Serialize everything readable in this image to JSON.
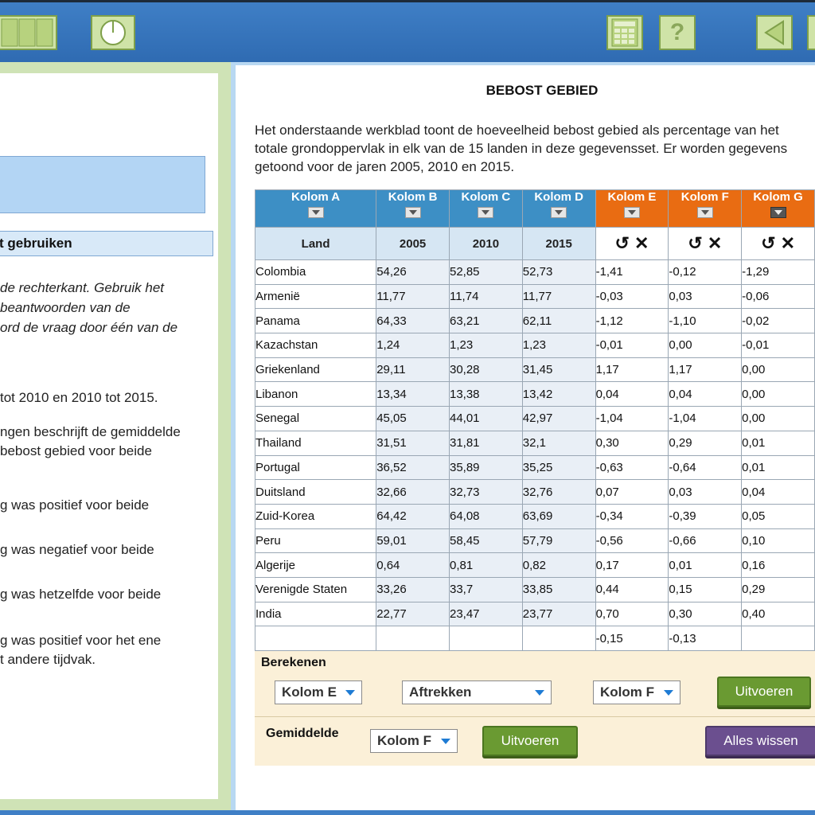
{
  "colors": {
    "toolbar": "#3577bd",
    "accent_blue": "#3d8fc5",
    "accent_orange": "#e96c12",
    "button_green": "#6a9a32",
    "button_purple": "#6b4f8f"
  },
  "toolbar": {
    "icons": [
      "grid-panel-icon",
      "timer-icon",
      "calculator-icon",
      "help-icon",
      "back-arrow-icon"
    ],
    "help_glyph": "?"
  },
  "left": {
    "section_head": "t gebruiken",
    "lines_italic": [
      "de rechterkant. Gebruik het",
      "beantwoorden van de",
      "ord de vraag door één van de"
    ],
    "line_period": "tot 2010 en 2010 tot 2015.",
    "question": [
      "ngen beschrijft de gemiddelde",
      "bebost gebied voor beide"
    ],
    "options": [
      [
        "g was positief voor beide"
      ],
      [
        "g was negatief voor beide"
      ],
      [
        "g was hetzelfde voor beide"
      ],
      [
        "g was positief voor het ene",
        "t andere tijdvak."
      ]
    ]
  },
  "main": {
    "title": "BEBOST GEBIED",
    "description": "Het onderstaande werkblad toont de hoeveelheid bebost gebied als percentage van het totale grondoppervlak in elk van de 15 landen in deze gegevensset. Er worden gegevens getoond voor de jaren 2005, 2010 en 2015."
  },
  "table": {
    "columns": [
      "Kolom A",
      "Kolom B",
      "Kolom C",
      "Kolom D",
      "Kolom E",
      "Kolom F",
      "Kolom G"
    ],
    "subheaders": [
      "Land",
      "2005",
      "2010",
      "2015"
    ],
    "rows": [
      [
        "Colombia",
        "54,26",
        "52,85",
        "52,73",
        "-1,41",
        "-0,12",
        "-1,29"
      ],
      [
        "Armenië",
        "11,77",
        "11,74",
        "11,77",
        "-0,03",
        "0,03",
        "-0,06"
      ],
      [
        "Panama",
        "64,33",
        "63,21",
        "62,11",
        "-1,12",
        "-1,10",
        "-0,02"
      ],
      [
        "Kazachstan",
        "1,24",
        "1,23",
        "1,23",
        "-0,01",
        "0,00",
        "-0,01"
      ],
      [
        "Griekenland",
        "29,11",
        "30,28",
        "31,45",
        "1,17",
        "1,17",
        "0,00"
      ],
      [
        "Libanon",
        "13,34",
        "13,38",
        "13,42",
        "0,04",
        "0,04",
        "0,00"
      ],
      [
        "Senegal",
        "45,05",
        "44,01",
        "42,97",
        "-1,04",
        "-1,04",
        "0,00"
      ],
      [
        "Thailand",
        "31,51",
        "31,81",
        "32,1",
        "0,30",
        "0,29",
        "0,01"
      ],
      [
        "Portugal",
        "36,52",
        "35,89",
        "35,25",
        "-0,63",
        "-0,64",
        "0,01"
      ],
      [
        "Duitsland",
        "32,66",
        "32,73",
        "32,76",
        "0,07",
        "0,03",
        "0,04"
      ],
      [
        "Zuid-Korea",
        "64,42",
        "64,08",
        "63,69",
        "-0,34",
        "-0,39",
        "0,05"
      ],
      [
        "Peru",
        "59,01",
        "58,45",
        "57,79",
        "-0,56",
        "-0,66",
        "0,10"
      ],
      [
        "Algerije",
        "0,64",
        "0,81",
        "0,82",
        "0,17",
        "0,01",
        "0,16"
      ],
      [
        "Verenigde Staten",
        "33,26",
        "33,7",
        "33,85",
        "0,44",
        "0,15",
        "0,29"
      ],
      [
        "India",
        "22,77",
        "23,47",
        "23,77",
        "0,70",
        "0,30",
        "0,40"
      ]
    ],
    "averages": [
      "",
      "",
      "",
      "",
      "-0,15",
      "-0,13",
      ""
    ]
  },
  "calc": {
    "compute_label": "Berekenen",
    "operand1": "Kolom E",
    "operation": "Aftrekken",
    "operand2": "Kolom F",
    "execute": "Uitvoeren",
    "average_label": "Gemiddelde",
    "average_col": "Kolom F",
    "average_execute": "Uitvoeren",
    "clear_all": "Alles wissen"
  }
}
